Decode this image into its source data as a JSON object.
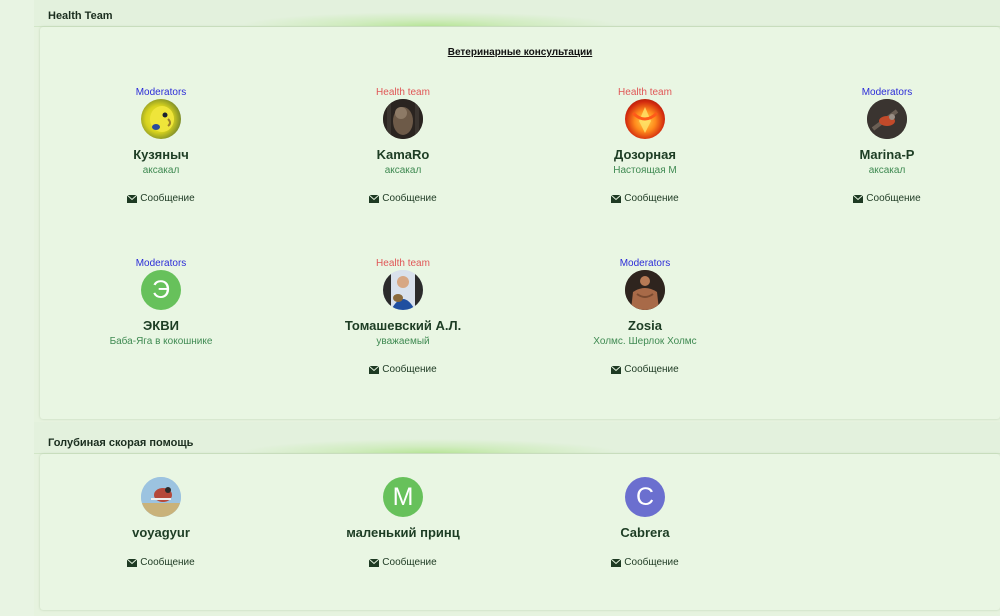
{
  "sections": [
    {
      "title": "Health Team",
      "subtitle": "Ветеринарные консультации",
      "members": [
        {
          "group": "Moderators",
          "group_color": "#2b2bd8",
          "name": "Кузяныч",
          "title": "аксакал",
          "message": "Сообщение",
          "avatar": "photo-budgie"
        },
        {
          "group": "Health team",
          "group_color": "#e05656",
          "name": "KamaRo",
          "title": "аксакал",
          "message": "Сообщение",
          "avatar": "photo-bird-dark"
        },
        {
          "group": "Health team",
          "group_color": "#e05656",
          "name": "Дозорная",
          "title": "Настоящая М",
          "message": "Сообщение",
          "avatar": "photo-phoenix"
        },
        {
          "group": "Moderators",
          "group_color": "#2b2bd8",
          "name": "Marina-P",
          "title": "аксакал",
          "message": "Сообщение",
          "avatar": "photo-bird-red"
        },
        {
          "group": "Moderators",
          "group_color": "#2b2bd8",
          "name": "ЭКВИ",
          "title": "Баба-Яга в кокошнике",
          "message": "",
          "avatar": "letter",
          "letter": "Э",
          "avatar_color": "#67c15b"
        },
        {
          "group": "Health team",
          "group_color": "#e05656",
          "name": "Томашевский А.Л.",
          "title": "уважаемый",
          "message": "Сообщение",
          "avatar": "photo-man-bird"
        },
        {
          "group": "Moderators",
          "group_color": "#2b2bd8",
          "name": "Zosia",
          "title": "Холмс. Шерлок Холмс",
          "message": "Сообщение",
          "avatar": "photo-muscle"
        }
      ]
    },
    {
      "title": "Голубиная скорая помощь",
      "members": [
        {
          "name": "voyagyur",
          "message": "Сообщение",
          "avatar": "photo-pigeon"
        },
        {
          "name": "маленький принц",
          "message": "Сообщение",
          "avatar": "letter",
          "letter": "М",
          "avatar_color": "#67c15b"
        },
        {
          "name": "Cabrera",
          "message": "Сообщение",
          "avatar": "letter",
          "letter": "C",
          "avatar_color": "#6b6fcf"
        }
      ]
    }
  ]
}
